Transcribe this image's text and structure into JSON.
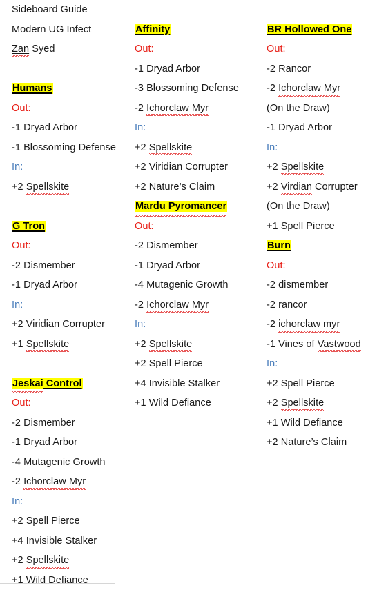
{
  "document": {
    "title": "Sideboard Guide",
    "subtitle": "Modern UG Infect",
    "author_first": "Zan",
    "author_last": "Syed"
  },
  "labels": {
    "out": "Out:",
    "in": "In:"
  },
  "colors": {
    "out": "#e8221a",
    "in": "#4a7ebb",
    "highlight": "#ffff00",
    "text": "#1a1a1a",
    "spellcheck": "#e02020"
  },
  "columns": [
    {
      "id": "column-left",
      "matchups": [
        {
          "deck": "Humans",
          "deck_misspelled": false,
          "out": [
            {
              "text": "-1 Dryad Arbor",
              "misspelled": ""
            },
            {
              "text": "-1 Blossoming Defense",
              "misspelled": ""
            }
          ],
          "in": [
            {
              "text": "+2 Spellskite",
              "misspelled": "Spellskite"
            }
          ]
        },
        {
          "deck": "G Tron",
          "deck_misspelled": false,
          "out": [
            {
              "text": "-2 Dismember",
              "misspelled": ""
            },
            {
              "text": "-1 Dryad Arbor",
              "misspelled": ""
            }
          ],
          "in": [
            {
              "text": "+2 Viridian Corrupter",
              "misspelled": ""
            },
            {
              "text": "+1 Spellskite",
              "misspelled": "Spellskite"
            }
          ]
        },
        {
          "deck": "Jeskai Control",
          "deck_misspelled": true,
          "deck_misspelled_word": "Jeskai",
          "out": [
            {
              "text": "-2 Dismember",
              "misspelled": ""
            },
            {
              "text": "-1 Dryad Arbor",
              "misspelled": ""
            },
            {
              "text": "-4 Mutagenic Growth",
              "misspelled": ""
            },
            {
              "text": "-2 Ichorclaw Myr",
              "misspelled": "Ichorclaw Myr"
            }
          ],
          "in": [
            {
              "text": "+2 Spell Pierce",
              "misspelled": ""
            },
            {
              "text": "+4 Invisible Stalker",
              "misspelled": ""
            },
            {
              "text": "+2 Spellskite",
              "misspelled": "Spellskite"
            },
            {
              "text": "+1 Wild Defiance",
              "misspelled": ""
            }
          ]
        }
      ]
    },
    {
      "id": "column-middle",
      "matchups": [
        {
          "deck": "Affinity",
          "deck_misspelled": false,
          "out": [
            {
              "text": "-1 Dryad Arbor",
              "misspelled": ""
            },
            {
              "text": "-3 Blossoming Defense",
              "misspelled": ""
            },
            {
              "text": "-2 Ichorclaw Myr",
              "misspelled": "Ichorclaw Myr"
            }
          ],
          "in": [
            {
              "text": "+2 Spellskite",
              "misspelled": "Spellskite"
            },
            {
              "text": "+2 Viridian Corrupter",
              "misspelled": ""
            },
            {
              "text": "+2 Nature’s Claim",
              "misspelled": ""
            }
          ]
        },
        {
          "deck": "Mardu Pyromancer",
          "deck_misspelled": true,
          "deck_misspelled_word": "Mardu Pyromancer",
          "out": [
            {
              "text": "-2 Dismember",
              "misspelled": ""
            },
            {
              "text": "-1 Dryad Arbor",
              "misspelled": ""
            },
            {
              "text": "-4 Mutagenic Growth",
              "misspelled": ""
            },
            {
              "text": "-2 Ichorclaw Myr",
              "misspelled": "Ichorclaw Myr"
            }
          ],
          "in": [
            {
              "text": "+2 Spellskite",
              "misspelled": "Spellskite"
            },
            {
              "text": "+2 Spell Pierce",
              "misspelled": ""
            },
            {
              "text": "+4 Invisible Stalker",
              "misspelled": ""
            },
            {
              "text": "+1 Wild Defiance",
              "misspelled": ""
            }
          ]
        }
      ]
    },
    {
      "id": "column-right",
      "matchups": [
        {
          "deck": "BR Hollowed One",
          "deck_misspelled": false,
          "out": [
            {
              "text": "-2 Rancor",
              "misspelled": ""
            },
            {
              "text": "-2 Ichorclaw Myr",
              "misspelled": "Ichorclaw Myr"
            },
            {
              "text": "(On the Draw)",
              "misspelled": ""
            },
            {
              "text": "-1 Dryad Arbor",
              "misspelled": ""
            }
          ],
          "in": [
            {
              "text": "+2 Spellskite",
              "misspelled": "Spellskite"
            },
            {
              "text": "+2 Virdian Corrupter",
              "misspelled": "Virdian"
            },
            {
              "text": "(On the Draw)",
              "misspelled": ""
            },
            {
              "text": "+1 Spell Pierce",
              "misspelled": ""
            }
          ]
        },
        {
          "deck": "Burn",
          "deck_misspelled": false,
          "out": [
            {
              "text": "-2 dismember",
              "misspelled": ""
            },
            {
              "text": "-2 rancor",
              "misspelled": ""
            },
            {
              "text": "-2 ichorclaw myr",
              "misspelled": "ichorclaw myr"
            },
            {
              "text": "-1 Vines of Vastwood",
              "misspelled": "Vastwood"
            }
          ],
          "in": [
            {
              "text": "+2 Spell Pierce",
              "misspelled": ""
            },
            {
              "text": "+2 Spellskite",
              "misspelled": "Spellskite"
            },
            {
              "text": "+1 Wild Defiance",
              "misspelled": ""
            },
            {
              "text": "+2 Nature’s Claim",
              "misspelled": ""
            }
          ]
        }
      ]
    }
  ]
}
